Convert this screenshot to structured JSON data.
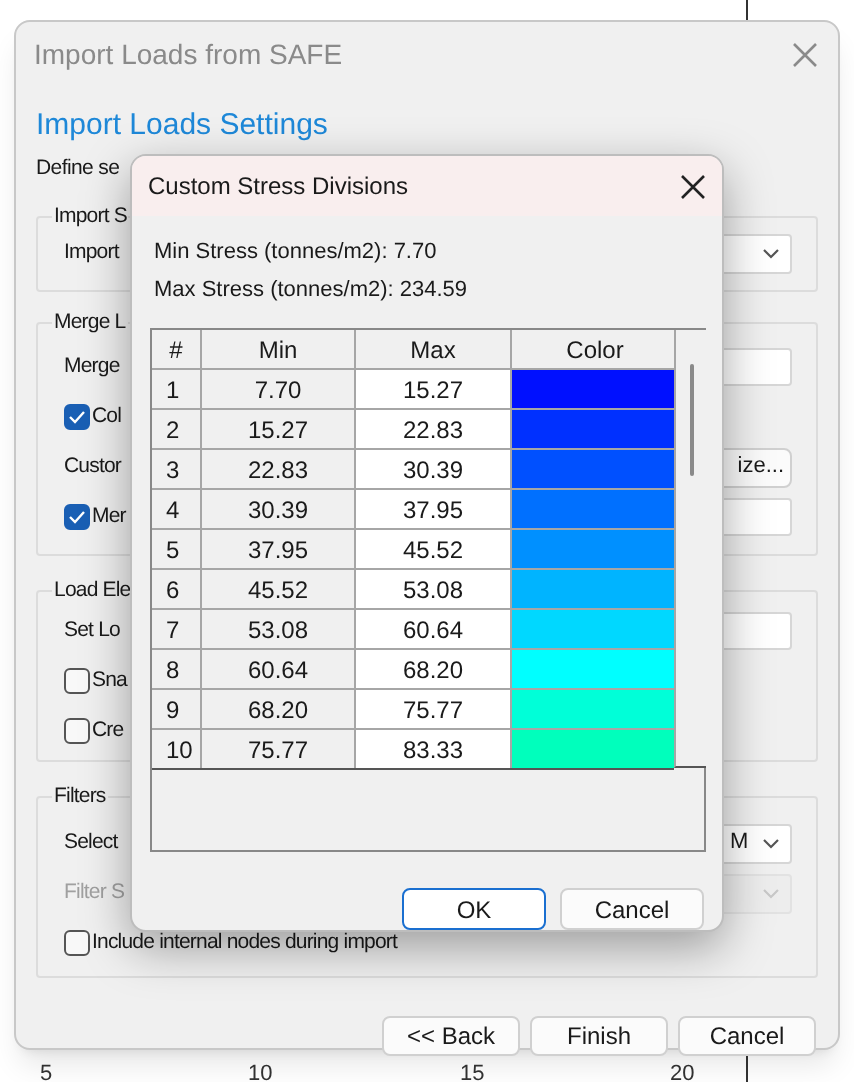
{
  "main_window": {
    "title": "Import Loads from SAFE",
    "heading": "Import Loads Settings",
    "intro": "Define se",
    "groups": [
      {
        "title": "Import S",
        "rows": [
          {
            "kind": "label",
            "label": "Import",
            "control": {
              "kind": "dropdown"
            }
          }
        ]
      },
      {
        "title": "Merge L",
        "rows": [
          {
            "kind": "label",
            "label": "Merge",
            "control": {
              "kind": "field"
            }
          },
          {
            "kind": "checkbox",
            "label": "Col",
            "checked": true
          },
          {
            "kind": "label",
            "label": "Custor",
            "control": {
              "kind": "button",
              "text": "ize..."
            }
          },
          {
            "kind": "checkbox",
            "label": "Mer",
            "checked": true,
            "control": {
              "kind": "field"
            }
          }
        ]
      },
      {
        "title": "Load Ele",
        "rows": [
          {
            "kind": "label",
            "label": "Set Lo",
            "control": {
              "kind": "field"
            }
          },
          {
            "kind": "checkbox",
            "label": "Sna",
            "checked": false
          },
          {
            "kind": "checkbox",
            "label": "Cre",
            "checked": false
          }
        ]
      },
      {
        "title": "Filters",
        "rows": [
          {
            "kind": "label",
            "label": "Select",
            "control": {
              "kind": "dropdown",
              "value": "M"
            }
          },
          {
            "kind": "label",
            "label": "Filter S",
            "disabled": true,
            "control": {
              "kind": "dropdown",
              "disabled": true
            }
          },
          {
            "kind": "checkbox",
            "label": "Include internal nodes during import",
            "checked": false
          }
        ]
      }
    ],
    "buttons": [
      "<< Back",
      "Finish",
      "Cancel"
    ]
  },
  "dialog": {
    "title": "Custom Stress Divisions",
    "min_stress": "Min Stress (tonnes/m2): 7.70",
    "max_stress": "Max Stress (tonnes/m2): 234.59",
    "columns": [
      "#",
      "Min",
      "Max",
      "Color"
    ],
    "rows": [
      {
        "index": "1",
        "min": "7.70",
        "max": "15.27",
        "color": "#0010ff"
      },
      {
        "index": "2",
        "min": "15.27",
        "max": "22.83",
        "color": "#0030ff"
      },
      {
        "index": "3",
        "min": "22.83",
        "max": "30.39",
        "color": "#0050ff"
      },
      {
        "index": "4",
        "min": "30.39",
        "max": "37.95",
        "color": "#0070ff"
      },
      {
        "index": "5",
        "min": "37.95",
        "max": "45.52",
        "color": "#0090ff"
      },
      {
        "index": "6",
        "min": "45.52",
        "max": "53.08",
        "color": "#00b4ff"
      },
      {
        "index": "7",
        "min": "53.08",
        "max": "60.64",
        "color": "#00d8ff"
      },
      {
        "index": "8",
        "min": "60.64",
        "max": "68.20",
        "color": "#00ffff"
      },
      {
        "index": "9",
        "min": "68.20",
        "max": "75.77",
        "color": "#00ffd8"
      },
      {
        "index": "10",
        "min": "75.77",
        "max": "83.33",
        "color": "#00ffbc"
      }
    ],
    "buttons": [
      {
        "label": "OK",
        "default": true
      },
      {
        "label": "Cancel",
        "default": false
      }
    ]
  },
  "axis_labels": [
    "5",
    "10",
    "15",
    "20"
  ]
}
